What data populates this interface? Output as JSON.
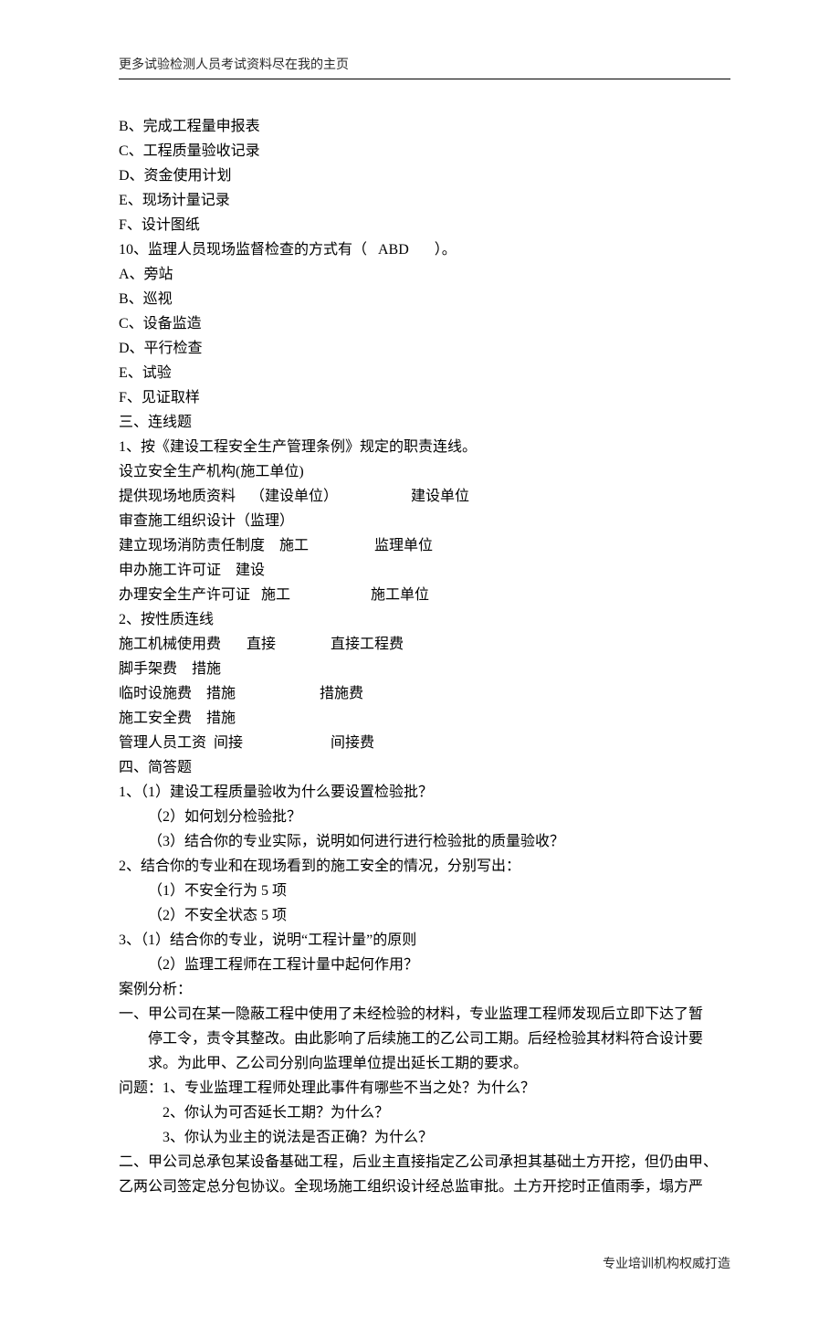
{
  "header": "更多试验检测人员考试资料尽在我的主页",
  "footer": "专业培训机构权威打造",
  "lines": [
    {
      "cls": "",
      "txt": "B、完成工程量申报表"
    },
    {
      "cls": "",
      "txt": "C、工程质量验收记录"
    },
    {
      "cls": "",
      "txt": "D、资金使用计划"
    },
    {
      "cls": "",
      "txt": "E、现场计量记录"
    },
    {
      "cls": "",
      "txt": "F、设计图纸"
    },
    {
      "cls": "",
      "txt": "10、监理人员现场监督检查的方式有（   ABD       ）。"
    },
    {
      "cls": "",
      "txt": "A、旁站"
    },
    {
      "cls": "",
      "txt": "B、巡视"
    },
    {
      "cls": "",
      "txt": "C、设备监造"
    },
    {
      "cls": "",
      "txt": "D、平行检查"
    },
    {
      "cls": "",
      "txt": "E、试验"
    },
    {
      "cls": "",
      "txt": "F、见证取样"
    },
    {
      "cls": "",
      "txt": "三、连线题"
    },
    {
      "cls": "",
      "txt": "1、按《建设工程安全生产管理条例》规定的职责连线。"
    },
    {
      "cls": "",
      "txt": "设立安全生产机构(施工单位)"
    },
    {
      "cls": "",
      "txt": "提供现场地质资料    （建设单位）                    建设单位"
    },
    {
      "cls": "",
      "txt": "审查施工组织设计（监理）"
    },
    {
      "cls": "",
      "txt": "建立现场消防责任制度    施工                  监理单位"
    },
    {
      "cls": "",
      "txt": "申办施工许可证    建设"
    },
    {
      "cls": "",
      "txt": "办理安全生产许可证   施工                      施工单位"
    },
    {
      "cls": "",
      "txt": "2、按性质连线"
    },
    {
      "cls": "",
      "txt": "施工机械使用费       直接               直接工程费"
    },
    {
      "cls": "",
      "txt": "脚手架费    措施"
    },
    {
      "cls": "",
      "txt": "临时设施费    措施                       措施费"
    },
    {
      "cls": "",
      "txt": "施工安全费    措施"
    },
    {
      "cls": "",
      "txt": "管理人员工资  间接                        间接费"
    },
    {
      "cls": "",
      "txt": "四、简答题"
    },
    {
      "cls": "",
      "txt": "1、（1）建设工程质量验收为什么要设置检验批？"
    },
    {
      "cls": "indent1",
      "txt": "（2）如何划分检验批？"
    },
    {
      "cls": "indent1",
      "txt": "（3）结合你的专业实际，说明如何进行进行检验批的质量验收？"
    },
    {
      "cls": "",
      "txt": "2、结合你的专业和在现场看到的施工安全的情况，分别写出："
    },
    {
      "cls": "indent1",
      "txt": "（1）不安全行为 5 项"
    },
    {
      "cls": "indent1",
      "txt": "（2）不安全状态 5 项"
    },
    {
      "cls": "",
      "txt": "3、（1）结合你的专业，说明“工程计量”的原则"
    },
    {
      "cls": "indent1",
      "txt": "（2）监理工程师在工程计量中起何作用？"
    },
    {
      "cls": "",
      "txt": "案例分析："
    },
    {
      "cls": "",
      "txt": "一、甲公司在某一隐蔽工程中使用了未经检验的材料，专业监理工程师发现后立即下达了暂"
    },
    {
      "cls": "indent1",
      "txt": "停工令，责令其整改。由此影响了后续施工的乙公司工期。后经检验其材料符合设计要"
    },
    {
      "cls": "indent1",
      "txt": "求。为此甲、乙公司分别向监理单位提出延长工期的要求。"
    },
    {
      "cls": "",
      "txt": "问题：1、专业监理工程师处理此事件有哪些不当之处？为什么？"
    },
    {
      "cls": "indent2",
      "txt": "2、你认为可否延长工期？为什么？"
    },
    {
      "cls": "indent2",
      "txt": "3、你认为业主的说法是否正确？为什么？"
    },
    {
      "cls": "",
      "txt": "二、甲公司总承包某设备基础工程，后业主直接指定乙公司承担其基础土方开挖，但仍由甲、"
    },
    {
      "cls": "",
      "txt": "乙两公司签定总分包协议。全现场施工组织设计经总监审批。土方开挖时正值雨季，塌方严"
    }
  ]
}
